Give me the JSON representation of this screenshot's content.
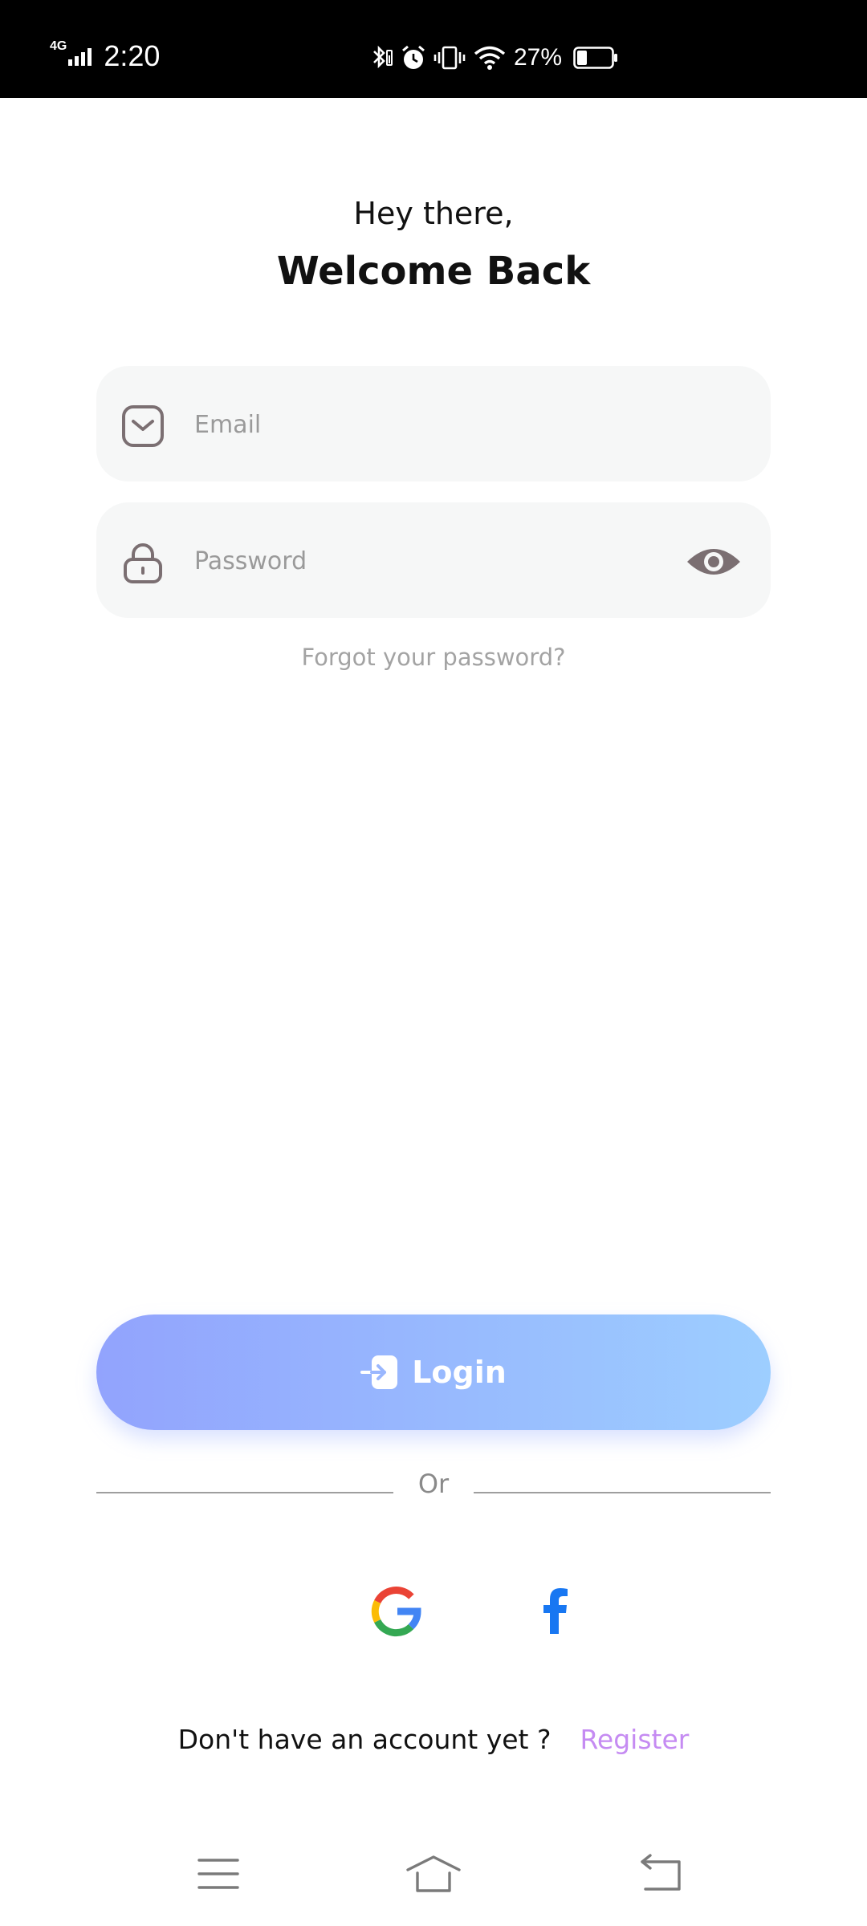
{
  "status_bar": {
    "time": "2:20",
    "network": "4G",
    "battery_percent": "27%",
    "icons": [
      "bluetooth-icon",
      "alarm-icon",
      "vibrate-icon",
      "wifi-icon",
      "battery-icon"
    ]
  },
  "header": {
    "greeting": "Hey there,",
    "title": "Welcome Back"
  },
  "form": {
    "email_placeholder": "Email",
    "email_value": "",
    "password_placeholder": "Password",
    "password_value": "",
    "forgot_password_label": "Forgot your password?"
  },
  "login_button": {
    "label": "Login"
  },
  "divider": {
    "label": "Or"
  },
  "social": {
    "providers": [
      "google-icon",
      "facebook-icon"
    ]
  },
  "signup": {
    "prompt": "Don't have an account yet ?",
    "register_label": "Register"
  },
  "nav_bar": {
    "icons": [
      "menu-icon",
      "home-icon",
      "back-icon"
    ]
  },
  "colors": {
    "status_bar_bg": "#000000",
    "background": "#ffffff",
    "field_bg": "#f6f7f7",
    "placeholder": "#9a9a9a",
    "button_gradient_start": "#92a3fd",
    "button_gradient_end": "#9dceff",
    "register_link": "#c58bf2",
    "muted_text": "#a3a3a3"
  }
}
